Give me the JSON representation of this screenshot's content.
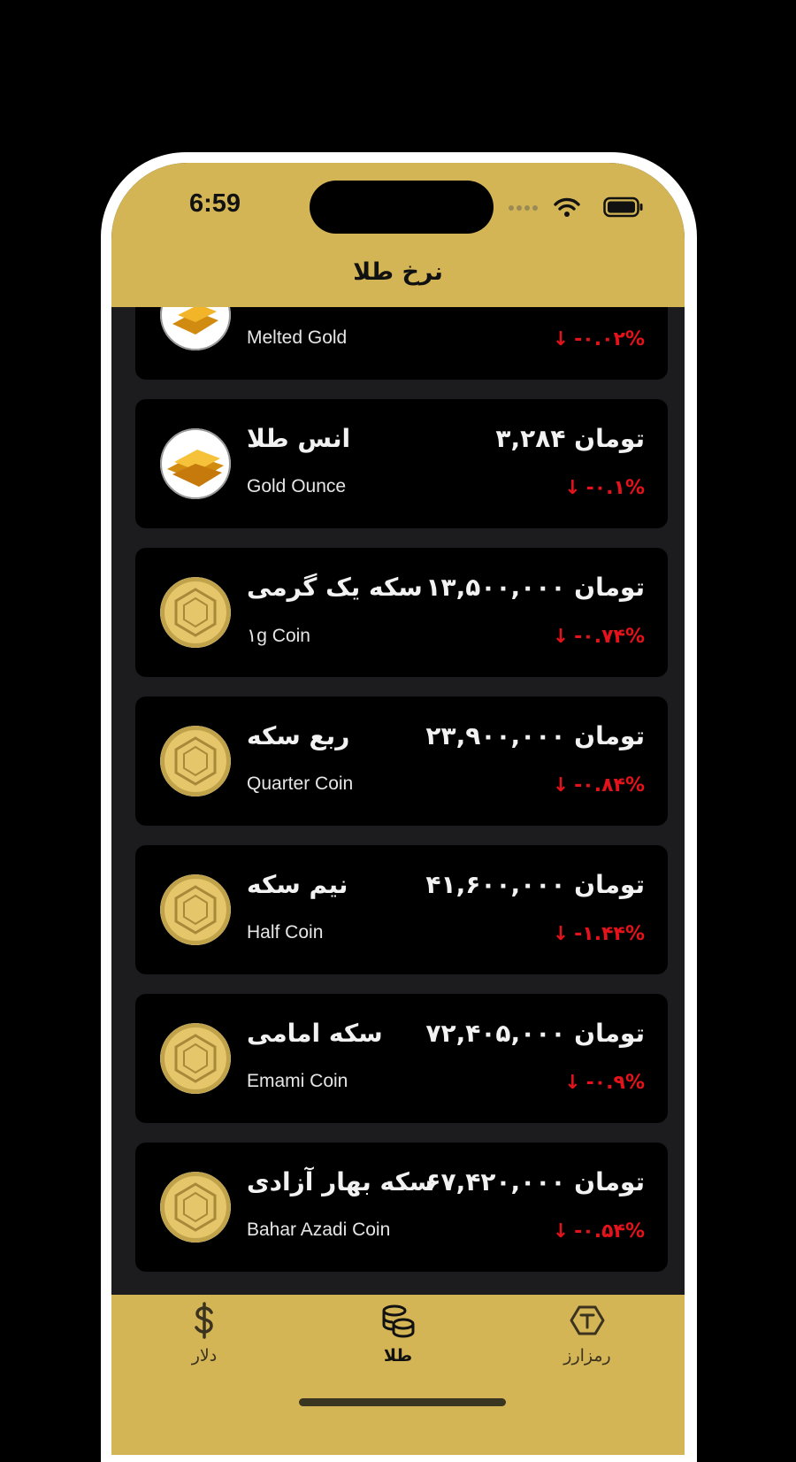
{
  "status_bar": {
    "time": "6:59"
  },
  "header": {
    "title": "نرخ طلا"
  },
  "items": [
    {
      "name_fa": "",
      "name_en": "Melted Gold",
      "price": "",
      "change": "-۰.۰۲%",
      "icon": "gold-bar-icon"
    },
    {
      "name_fa": "انس طلا",
      "name_en": "Gold Ounce",
      "price": "۳,۲۸۴ تومان",
      "change": "-۰.۱%",
      "icon": "gold-bar-icon"
    },
    {
      "name_fa": "سکه یک گرمی",
      "name_en": "۱g Coin",
      "price": "۱۳,۵۰۰,۰۰۰ تومان",
      "change": "-۰.۷۴%",
      "icon": "gold-coin-icon"
    },
    {
      "name_fa": "ربع سکه",
      "name_en": "Quarter Coin",
      "price": "۲۳,۹۰۰,۰۰۰ تومان",
      "change": "-۰.۸۴%",
      "icon": "gold-coin-icon"
    },
    {
      "name_fa": "نیم سکه",
      "name_en": "Half Coin",
      "price": "۴۱,۶۰۰,۰۰۰ تومان",
      "change": "-۱.۴۴%",
      "icon": "gold-coin-icon"
    },
    {
      "name_fa": "سکه امامی",
      "name_en": "Emami Coin",
      "price": "۷۲,۴۰۵,۰۰۰ تومان",
      "change": "-۰.۹%",
      "icon": "gold-coin-icon"
    },
    {
      "name_fa": "سکه بهار آزادی",
      "name_en": "Bahar Azadi Coin",
      "price": "۶۷,۴۲۰,۰۰۰ تومان",
      "change": "-۰.۵۴%",
      "icon": "gold-coin-icon"
    }
  ],
  "tabs": [
    {
      "label": "دلار",
      "icon": "dollar-icon",
      "active": false
    },
    {
      "label": "طلا",
      "icon": "coins-stack-icon",
      "active": true
    },
    {
      "label": "رمزارز",
      "icon": "crypto-token-icon",
      "active": false
    }
  ],
  "colors": {
    "accent": "#d4b555",
    "card": "#000000",
    "background": "#1c1c1e",
    "negative": "#e3121b"
  }
}
